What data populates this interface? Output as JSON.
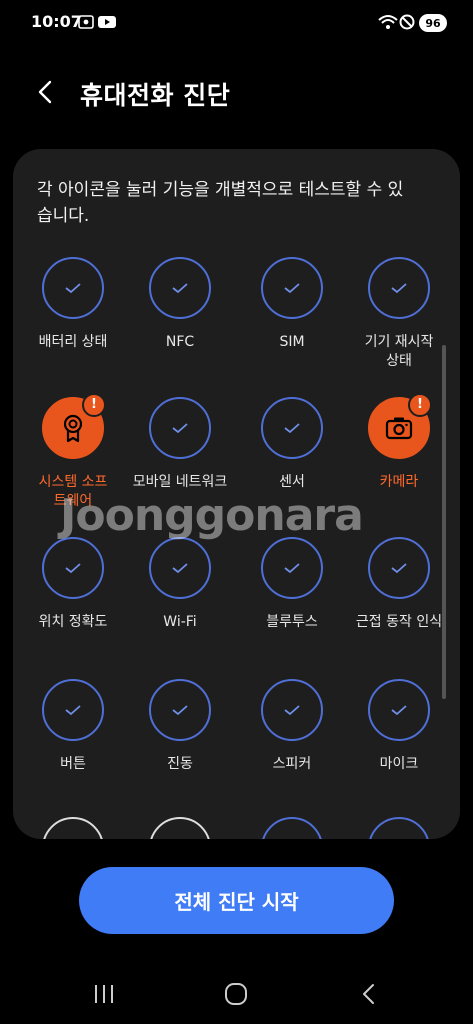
{
  "status": {
    "time": "10:07",
    "battery": "96"
  },
  "header": {
    "title": "휴대전화 진단"
  },
  "description": "각 아이콘을 눌러 기능을 개별적으로 테스트할 수 있습니다.",
  "tests": [
    {
      "label": "배터리 상태",
      "state": "checked"
    },
    {
      "label": "NFC",
      "state": "checked"
    },
    {
      "label": "SIM",
      "state": "checked"
    },
    {
      "label": "기기 재시작 상태",
      "state": "checked"
    },
    {
      "label": "시스템 소프트웨어",
      "state": "alert",
      "icon": "badge-icon"
    },
    {
      "label": "모바일 네트워크",
      "state": "checked"
    },
    {
      "label": "센서",
      "state": "checked"
    },
    {
      "label": "카메라",
      "state": "alert",
      "icon": "camera-icon"
    },
    {
      "label": "위치 정확도",
      "state": "checked"
    },
    {
      "label": "Wi-Fi",
      "state": "checked"
    },
    {
      "label": "블루투스",
      "state": "checked"
    },
    {
      "label": "근접 동작 인식",
      "state": "checked"
    },
    {
      "label": "버튼",
      "state": "checked"
    },
    {
      "label": "진동",
      "state": "checked"
    },
    {
      "label": "스피커",
      "state": "checked"
    },
    {
      "label": "마이크",
      "state": "checked"
    }
  ],
  "alert_mark": "!",
  "watermark": "Joonggonara",
  "start_button": "전체 진단 시작",
  "colors": {
    "accent": "#3f7cf5",
    "alert": "#e8561d",
    "ring": "#4f6fd6",
    "card": "#1e1e1e"
  }
}
